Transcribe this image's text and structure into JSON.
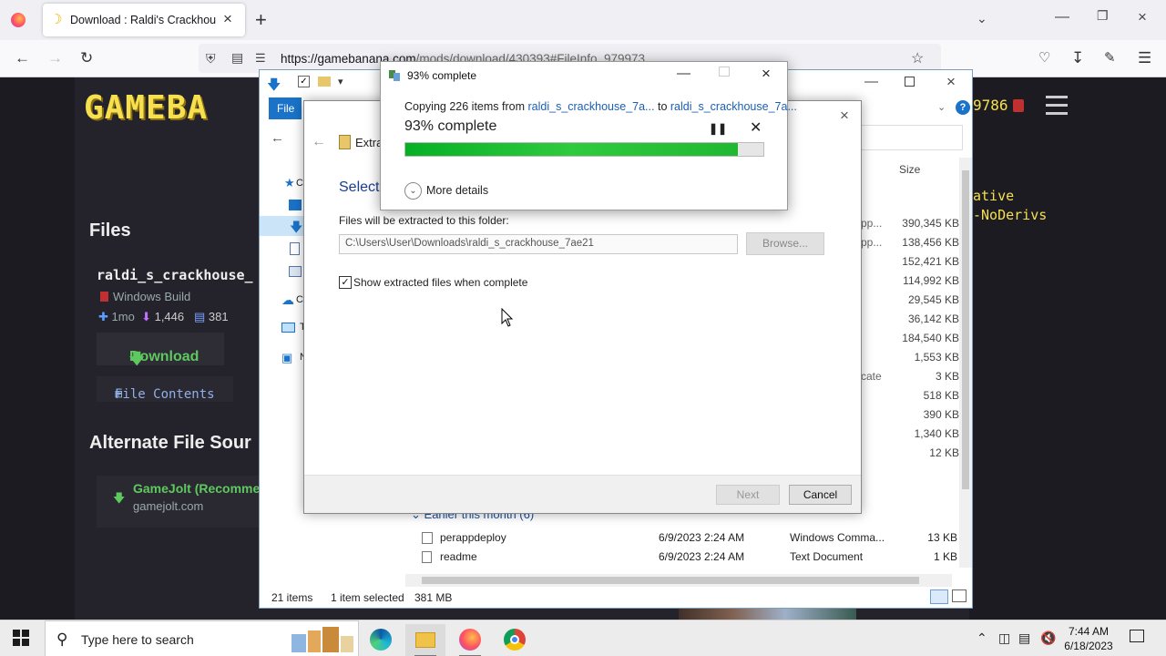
{
  "browser": {
    "tab_title": "Download : Raldi's Crackhouse",
    "url_host": "https://gamebanana.com",
    "url_path": "/mods/download/430393#FileInfo_979973"
  },
  "site": {
    "logo": "GAMEBA",
    "points": "9786",
    "license_lines": [
      "ative",
      "-NoDerivs"
    ],
    "files_heading": "Files",
    "mod_name": "raldi_s_crackhouse_",
    "build": "Windows Build",
    "age": "1mo",
    "downloads": "1,446",
    "files_count": "381",
    "download_label": "Download",
    "file_contents_label": "File Contents",
    "alt_heading": "Alternate File Sour",
    "alt_title": "GameJolt (Recomme",
    "alt_domain": "gamejolt.com"
  },
  "explorer": {
    "file_tab": "File",
    "col_size": "Size",
    "sizes": [
      "390,345 KB",
      "138,456 KB",
      "152,421 KB",
      "114,992 KB",
      "29,545 KB",
      "36,142 KB",
      "184,540 KB",
      "1,553 KB",
      "3 KB",
      "518 KB",
      "390 KB",
      "1,340 KB",
      "12 KB"
    ],
    "types_partial": [
      "pp...",
      "pp...",
      "",
      "",
      "",
      "",
      "",
      "",
      "cate",
      "",
      "",
      "",
      ""
    ],
    "group_header": "Earlier this month (6)",
    "rows": [
      {
        "name": "perappdeploy",
        "date": "6/9/2023 2:24 AM",
        "type": "Windows Comma...",
        "size": "13 KB"
      },
      {
        "name": "readme",
        "date": "6/9/2023 2:24 AM",
        "type": "Text Document",
        "size": "1 KB"
      }
    ],
    "status_count": "21 items",
    "status_selected": "1 item selected",
    "status_size": "381 MB"
  },
  "wizard": {
    "title": "Extra",
    "heading": "Select",
    "folder_label": "Files will be extracted to this folder:",
    "path_value": "C:\\Users\\User\\Downloads\\raldi_s_crackhouse_7ae21",
    "browse_label": "Browse...",
    "show_files_label": "Show extracted files when complete",
    "show_files_checked": true,
    "next_label": "Next",
    "cancel_label": "Cancel"
  },
  "progress": {
    "title": "93% complete",
    "copy_prefix": "Copying 226 items from",
    "source": "raldi_s_crackhouse_7a...",
    "to_word": "to",
    "destination": "raldi_s_crackhouse_7a...",
    "percent_label": "93% complete",
    "percent_value": 0.93,
    "more_details": "More details",
    "bar_color": "#06b025"
  },
  "taskbar": {
    "search_placeholder": "Type here to search",
    "time": "7:44 AM",
    "date": "6/18/2023",
    "apps": [
      "edge-icon",
      "file-explorer-icon",
      "firefox-icon",
      "chrome-icon"
    ]
  }
}
